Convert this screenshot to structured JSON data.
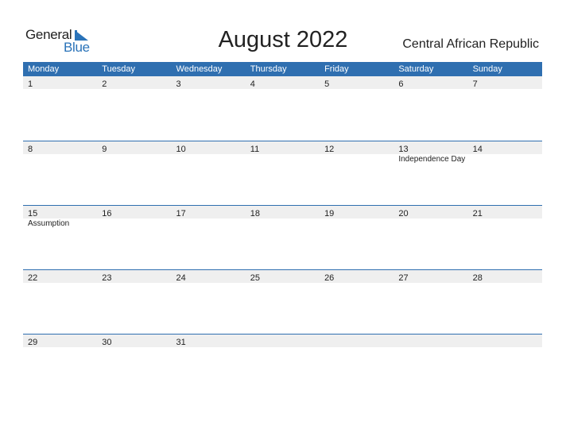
{
  "logo": {
    "general": "General",
    "blue": "Blue"
  },
  "header": {
    "title": "August 2022",
    "country": "Central African Republic"
  },
  "colors": {
    "accent": "#2f6fb0",
    "strip": "#efefef",
    "logo_blue": "#2a73b9"
  },
  "weekdays": [
    "Monday",
    "Tuesday",
    "Wednesday",
    "Thursday",
    "Friday",
    "Saturday",
    "Sunday"
  ],
  "weeks": [
    {
      "days": [
        {
          "n": "1",
          "e": ""
        },
        {
          "n": "2",
          "e": ""
        },
        {
          "n": "3",
          "e": ""
        },
        {
          "n": "4",
          "e": ""
        },
        {
          "n": "5",
          "e": ""
        },
        {
          "n": "6",
          "e": ""
        },
        {
          "n": "7",
          "e": ""
        }
      ]
    },
    {
      "days": [
        {
          "n": "8",
          "e": ""
        },
        {
          "n": "9",
          "e": ""
        },
        {
          "n": "10",
          "e": ""
        },
        {
          "n": "11",
          "e": ""
        },
        {
          "n": "12",
          "e": ""
        },
        {
          "n": "13",
          "e": "Independence Day"
        },
        {
          "n": "14",
          "e": ""
        }
      ]
    },
    {
      "days": [
        {
          "n": "15",
          "e": "Assumption"
        },
        {
          "n": "16",
          "e": ""
        },
        {
          "n": "17",
          "e": ""
        },
        {
          "n": "18",
          "e": ""
        },
        {
          "n": "19",
          "e": ""
        },
        {
          "n": "20",
          "e": ""
        },
        {
          "n": "21",
          "e": ""
        }
      ]
    },
    {
      "days": [
        {
          "n": "22",
          "e": ""
        },
        {
          "n": "23",
          "e": ""
        },
        {
          "n": "24",
          "e": ""
        },
        {
          "n": "25",
          "e": ""
        },
        {
          "n": "26",
          "e": ""
        },
        {
          "n": "27",
          "e": ""
        },
        {
          "n": "28",
          "e": ""
        }
      ]
    },
    {
      "days": [
        {
          "n": "29",
          "e": ""
        },
        {
          "n": "30",
          "e": ""
        },
        {
          "n": "31",
          "e": ""
        },
        {
          "n": "",
          "e": ""
        },
        {
          "n": "",
          "e": ""
        },
        {
          "n": "",
          "e": ""
        },
        {
          "n": "",
          "e": ""
        }
      ]
    }
  ]
}
